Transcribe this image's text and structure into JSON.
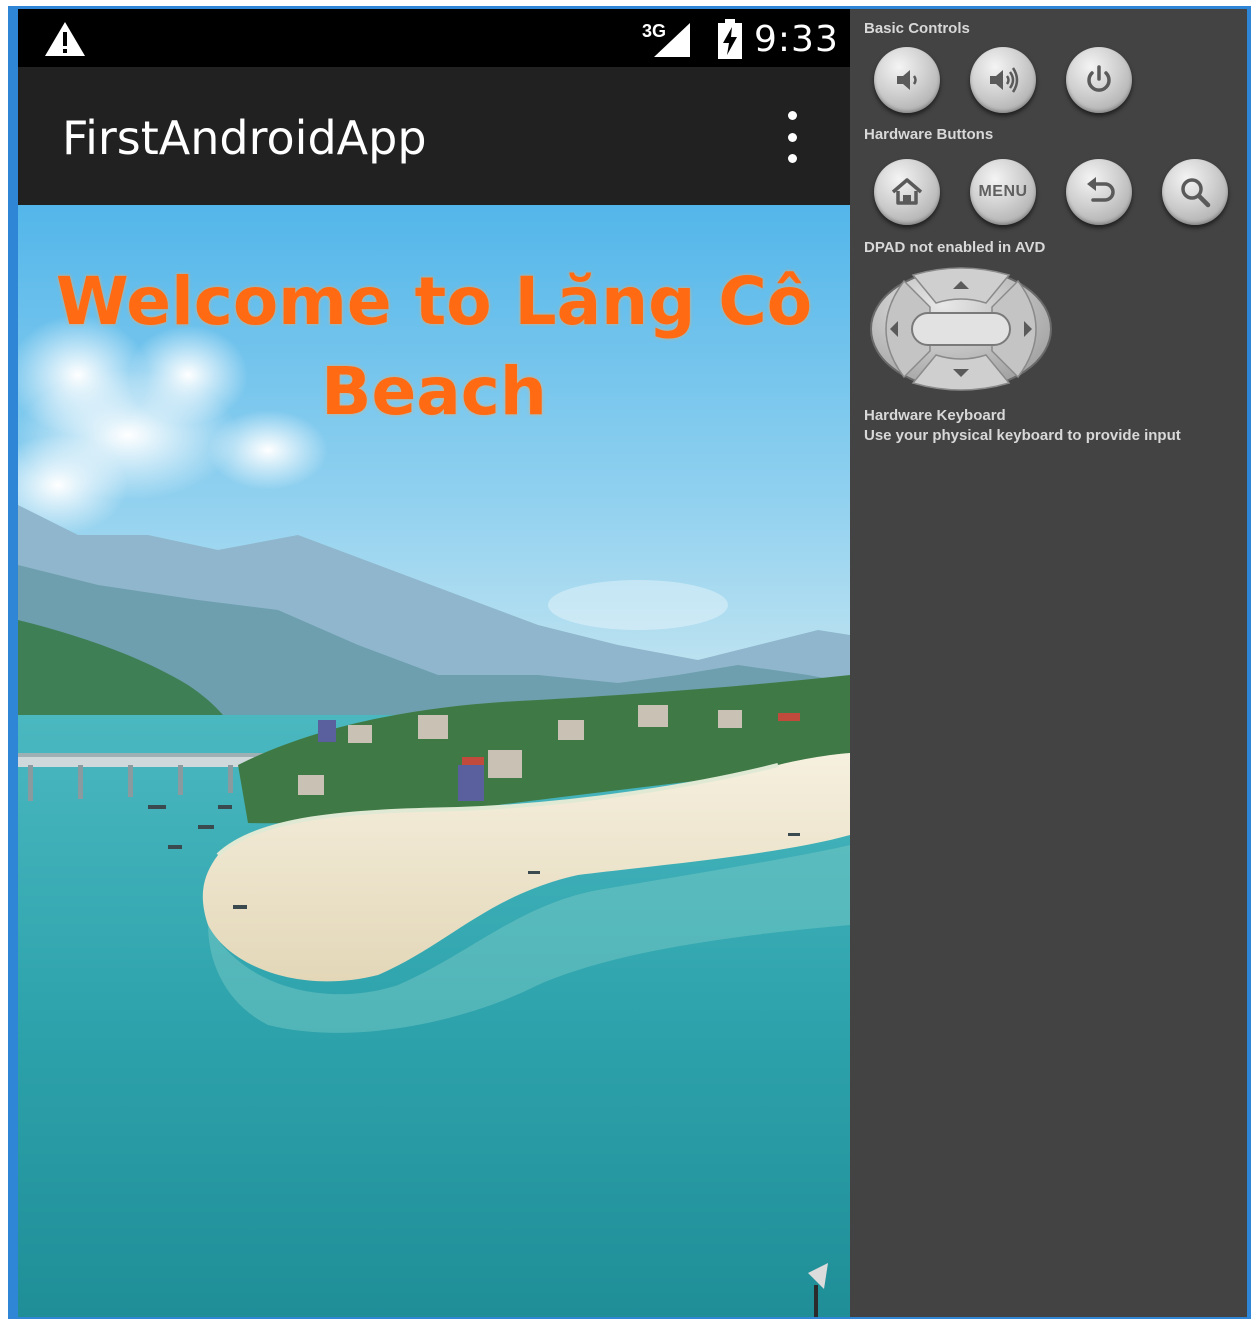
{
  "status_bar": {
    "network": "3G",
    "time": "9:33",
    "icons": [
      "warning-icon",
      "signal-icon",
      "battery-charging-icon"
    ]
  },
  "app": {
    "title": "FirstAndroidApp",
    "overflow_icon": "overflow-menu-icon",
    "welcome_line_1": "Welcome to Lăng Cô",
    "welcome_line_2": "Beach",
    "welcome_color": "#ff6a13"
  },
  "controls": {
    "basic_controls_label": "Basic Controls",
    "basic_buttons": [
      "volume-down-icon",
      "volume-up-icon",
      "power-icon"
    ],
    "hardware_buttons_label": "Hardware Buttons",
    "hardware_buttons": [
      "home-icon",
      "menu-button",
      "back-icon",
      "search-icon"
    ],
    "menu_label": "MENU",
    "dpad_label": "DPAD not enabled in AVD",
    "keyboard_title": "Hardware Keyboard",
    "keyboard_desc": "Use your physical keyboard to provide input"
  },
  "colors": {
    "frame_border": "#2f86d6",
    "action_bar": "#212121",
    "panel": "#434343"
  }
}
